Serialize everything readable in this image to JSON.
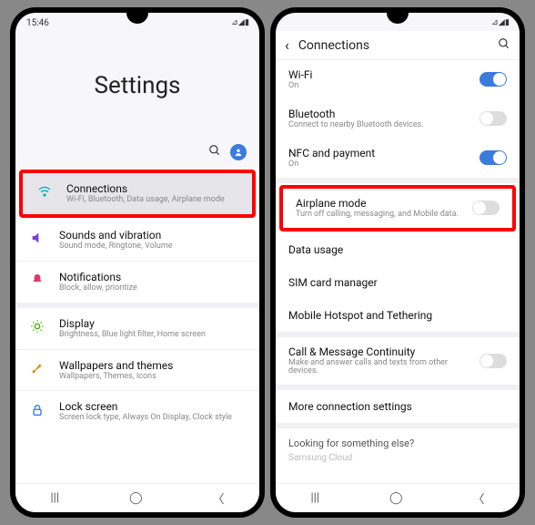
{
  "status": {
    "time": "15:46",
    "icons": "▸",
    "signal": "⊿ ◢ ▮"
  },
  "left": {
    "hero": "Settings",
    "items": [
      {
        "title": "Connections",
        "sub": "Wi-Fi, Bluetooth, Data usage, Airplane mode"
      },
      {
        "title": "Sounds and vibration",
        "sub": "Sound mode, Ringtone, Volume"
      },
      {
        "title": "Notifications",
        "sub": "Block, allow, prioritize"
      },
      {
        "title": "Display",
        "sub": "Brightness, Blue light filter, Home screen"
      },
      {
        "title": "Wallpapers and themes",
        "sub": "Wallpapers, Themes, Icons"
      },
      {
        "title": "Lock screen",
        "sub": "Screen lock type, Always On Display, Clock style"
      }
    ]
  },
  "right": {
    "header": "Connections",
    "items": {
      "wifi": {
        "title": "Wi-Fi",
        "sub": "On"
      },
      "bt": {
        "title": "Bluetooth",
        "sub": "Connect to nearby Bluetooth devices."
      },
      "nfc": {
        "title": "NFC and payment",
        "sub": "On"
      },
      "airplane": {
        "title": "Airplane mode",
        "sub": "Turn off calling, messaging, and Mobile data."
      },
      "data": {
        "title": "Data usage"
      },
      "sim": {
        "title": "SIM card manager"
      },
      "hotspot": {
        "title": "Mobile Hotspot and Tethering"
      },
      "cmc": {
        "title": "Call & Message Continuity",
        "sub": "Make and answer calls and texts from other devices."
      },
      "more": {
        "title": "More connection settings"
      }
    },
    "looking": "Looking for something else?",
    "faint": "Samsung Cloud"
  }
}
